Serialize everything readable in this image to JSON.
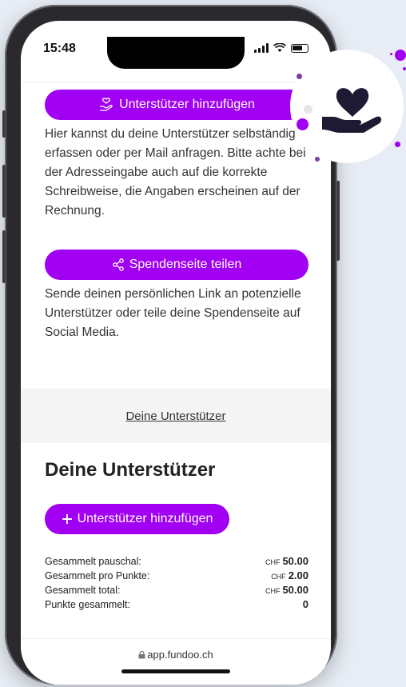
{
  "status": {
    "time": "15:48"
  },
  "sections": {
    "add_supporter_button": "Unterstützer hinzufügen",
    "add_supporter_text": "Hier kannst du deine Unterstützer selbständig erfassen oder per Mail anfragen. Bitte achte bei der Adresseingabe auch auf die korrekte Schreibweise, die Angaben erscheinen auf der Rechnung.",
    "share_button": "Spendenseite teilen",
    "share_text": "Sende deinen persönlichen Link an potenzielle Unterstützer oder teile deine Spendenseite auf Social Media."
  },
  "supporters_link": "Deine Unterstützer",
  "supporters": {
    "title": "Deine Unterstützer",
    "add_button": "Unterstützer hinzufügen",
    "stats": [
      {
        "label": "Gesammelt pauschal:",
        "currency": "CHF",
        "value": "50.00"
      },
      {
        "label": "Gesammelt pro Punkte:",
        "currency": "CHF",
        "value": "2.00"
      },
      {
        "label": "Gesammelt total:",
        "currency": "CHF",
        "value": "50.00"
      },
      {
        "label": "Punkte gesammelt:",
        "currency": "",
        "value": "0"
      }
    ]
  },
  "footer": {
    "url": "app.fundoo.ch"
  },
  "colors": {
    "accent": "#a100f2",
    "icon": "#1e1a33"
  },
  "icons": [
    "heart-hand-icon",
    "share-icon",
    "plus-icon",
    "lock-icon",
    "hand-icon"
  ]
}
